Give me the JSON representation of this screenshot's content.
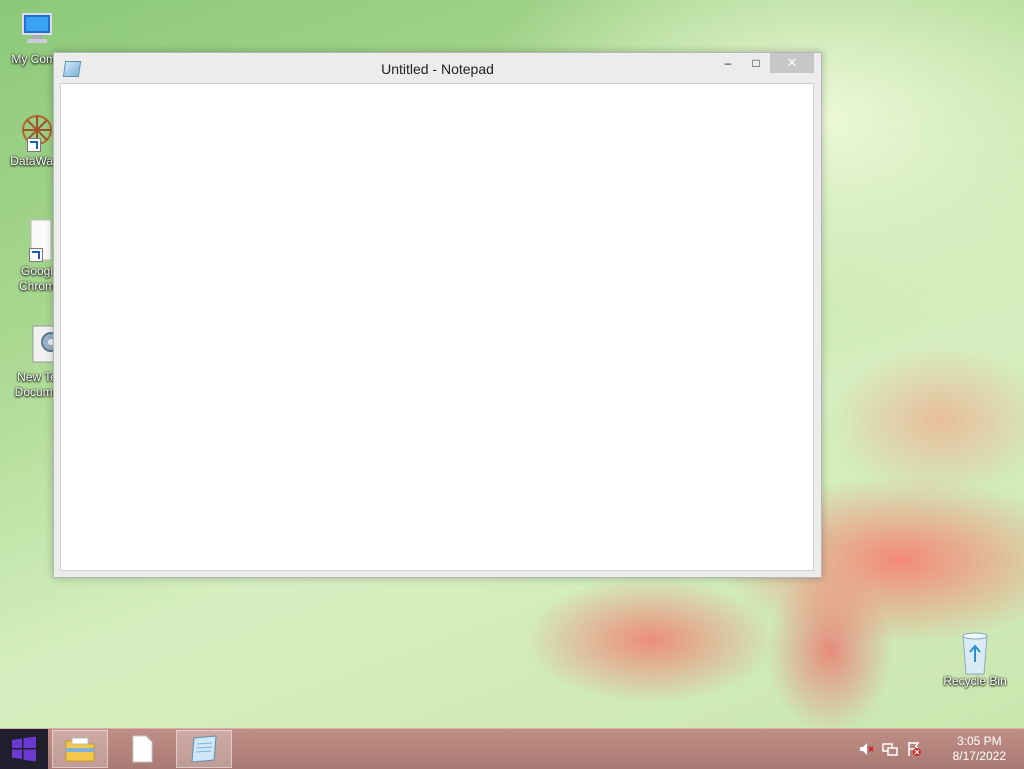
{
  "desktop": {
    "icons": [
      {
        "label": "My Comp"
      },
      {
        "label": "DataWag"
      },
      {
        "label_line1": "Googl",
        "label_line2": "Chrom"
      },
      {
        "label_line1": "New Te",
        "label_line2": "Docume"
      },
      {
        "label": "Recycle Bin"
      }
    ]
  },
  "window": {
    "title": "Untitled - Notepad",
    "minimize_glyph": "–",
    "maximize_glyph": "□",
    "close_glyph": "✕",
    "content": ""
  },
  "taskbar": {
    "items": [
      {
        "icon": "windows-logo-icon"
      },
      {
        "icon": "file-explorer-icon"
      },
      {
        "icon": "blank-document-icon"
      },
      {
        "icon": "notepad-icon",
        "active": true
      }
    ],
    "tray": {
      "icons": [
        "volume-muted-icon",
        "network-icon",
        "action-center-flag-icon"
      ],
      "time": "3:05 PM",
      "date": "8/17/2022"
    }
  },
  "colors": {
    "taskbar": "#b3837c",
    "start_logo": "#5b2ea6",
    "close_button": "#c7c7c7"
  }
}
